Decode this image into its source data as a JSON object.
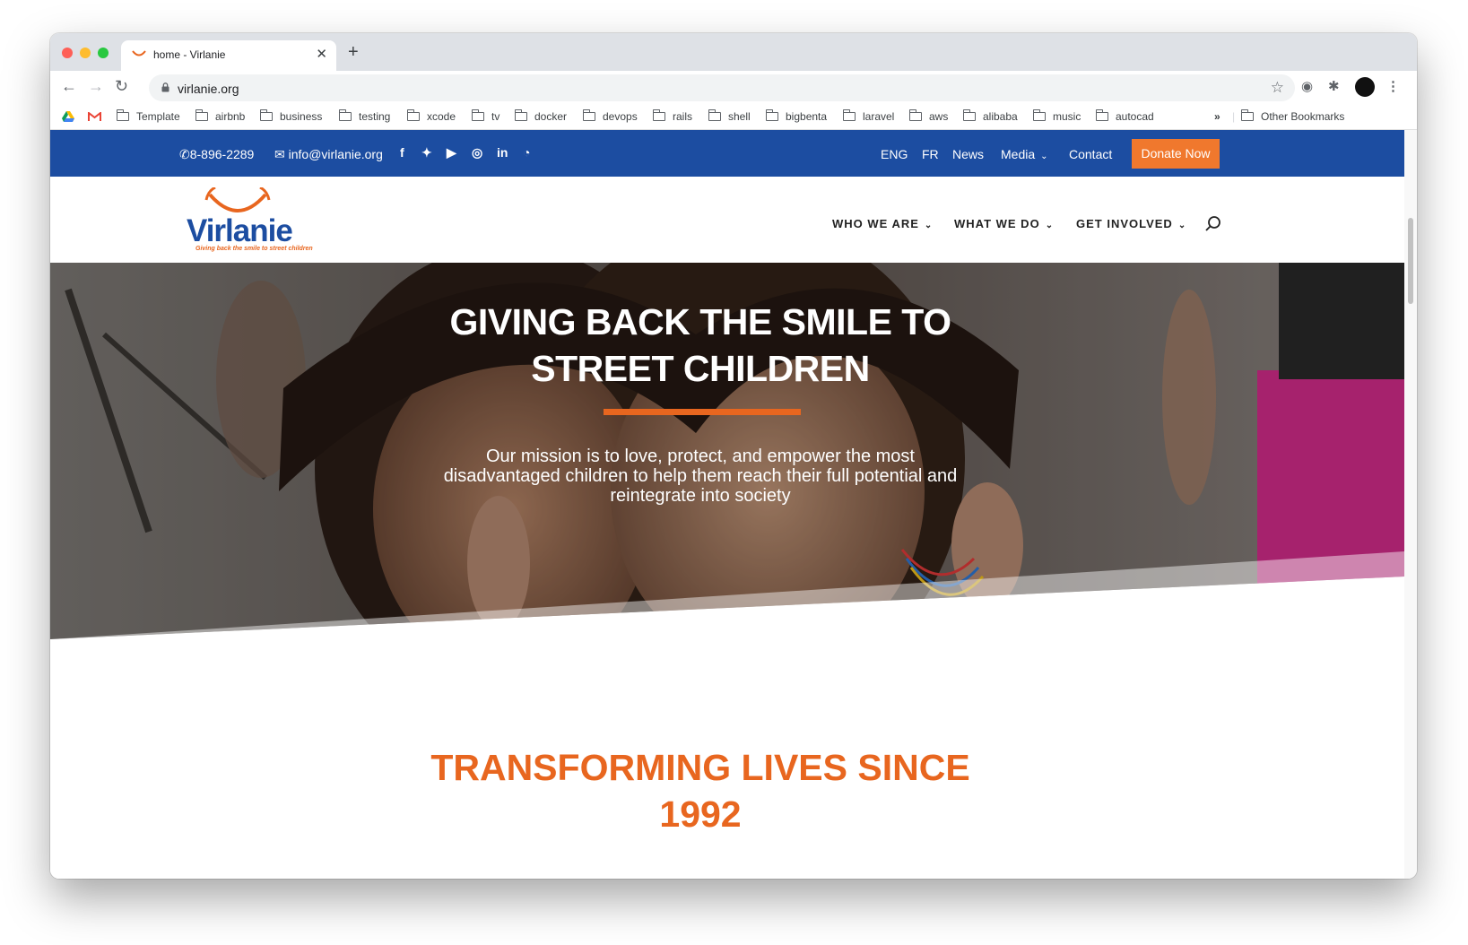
{
  "browser": {
    "tab_title": "home - Virlanie",
    "url": "virlanie.org",
    "bookmarks": [
      "Template",
      "airbnb",
      "business",
      "testing",
      "xcode",
      "tv",
      "docker",
      "devops",
      "rails",
      "shell",
      "bigbenta",
      "laravel",
      "aws",
      "alibaba",
      "music",
      "autocad"
    ],
    "overflow": "»",
    "other_bookmarks": "Other Bookmarks"
  },
  "topbar": {
    "phone": "8-896-2289",
    "email": "info@virlanie.org",
    "social": [
      "facebook-icon",
      "twitter-icon",
      "youtube-icon",
      "instagram-icon",
      "linkedin-icon",
      "rss-icon"
    ],
    "links": [
      "ENG",
      "FR",
      "News",
      "Media",
      "Contact"
    ],
    "donate": "Donate Now"
  },
  "header": {
    "logo": "Virlanie",
    "tagline": "Giving back the smile to street children",
    "nav": [
      "WHO WE ARE",
      "WHAT WE DO",
      "GET INVOLVED"
    ]
  },
  "hero": {
    "title": "GIVING BACK THE SMILE TO STREET CHILDREN",
    "subtitle": "Our mission is to love, protect, and empower the most disadvantaged children to help them reach their full potential and reintegrate into society"
  },
  "section2": {
    "title": "TRANSFORMING LIVES SINCE 1992"
  },
  "colors": {
    "brand_blue": "#1c4da1",
    "brand_orange": "#e8661f",
    "donate_orange": "#f0782d"
  }
}
